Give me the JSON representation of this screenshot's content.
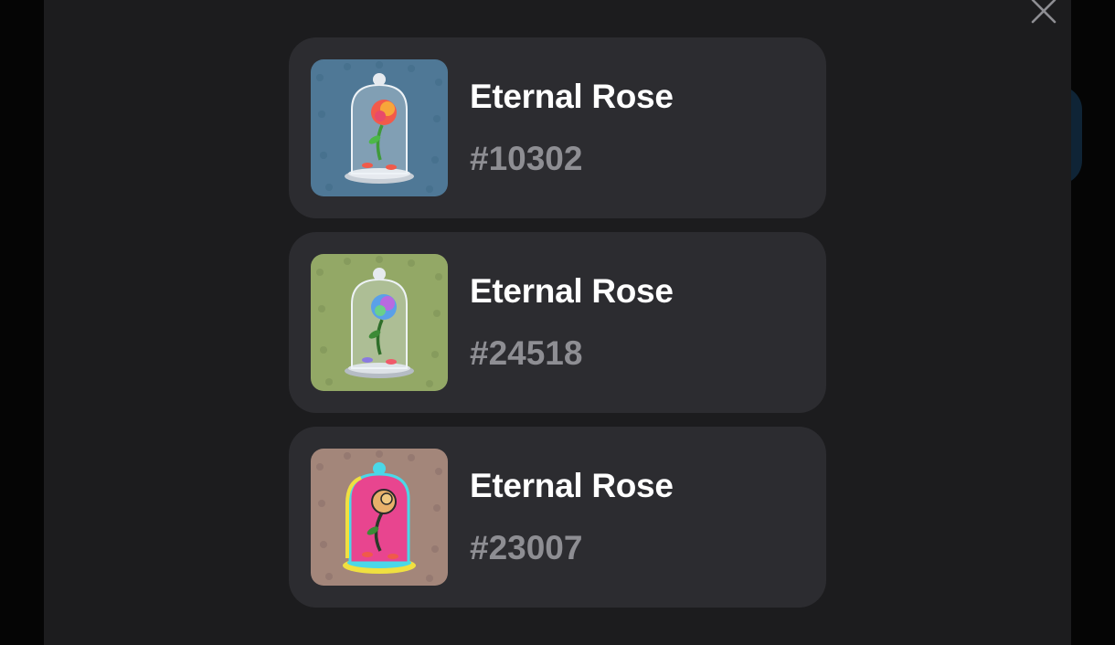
{
  "modal": {
    "close_icon": "close-icon"
  },
  "items": [
    {
      "name": "Eternal Rose",
      "number": "#10302",
      "background": "#4f7896",
      "theme": "blue"
    },
    {
      "name": "Eternal Rose",
      "number": "#24518",
      "background": "#93a866",
      "theme": "green"
    },
    {
      "name": "Eternal Rose",
      "number": "#23007",
      "background": "#a3867a",
      "theme": "pink"
    }
  ],
  "colors": {
    "modal_bg": "#1c1c1e",
    "card_bg": "#2c2c30",
    "title_text": "#ffffff",
    "number_text": "#8e8e93"
  }
}
